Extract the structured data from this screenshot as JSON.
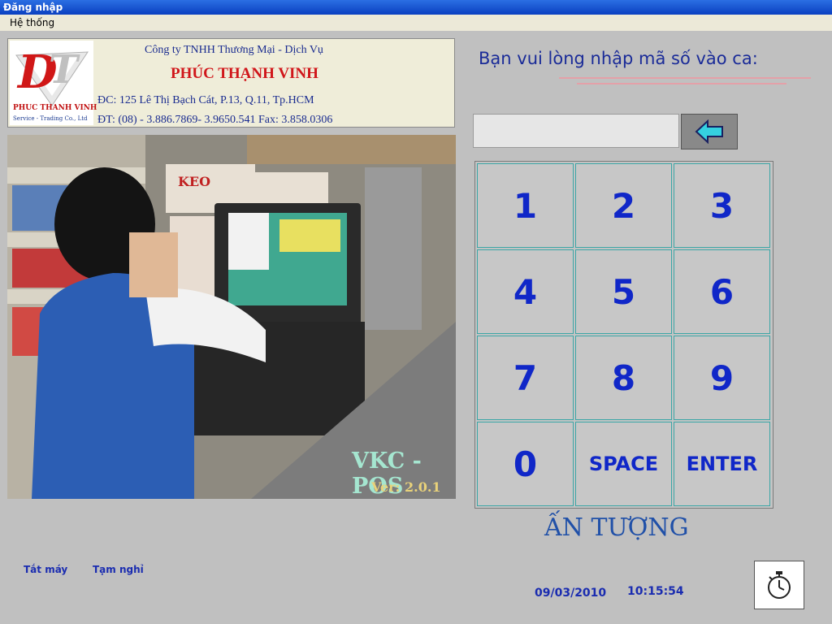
{
  "window": {
    "title": "Đăng nhập"
  },
  "menu": {
    "system": "Hệ thống"
  },
  "company": {
    "line1": "Công ty TNHH Thương Mại - Dịch Vụ",
    "name": "PHÚC THẠNH VINH",
    "address": "ĐC: 125 Lê Thị Bạch Cát, P.13, Q.11, Tp.HCM",
    "phone": "ĐT: (08) - 3.886.7869- 3.9650.541 Fax: 3.858.0306",
    "logo_text_1": "PHUC THANH VINH",
    "logo_text_2": "Service - Trading Co., Ltd"
  },
  "photo": {
    "brand": "VKC -POS",
    "version": "Ver: 2.0.1",
    "shelf_label": "KEO"
  },
  "login": {
    "prompt": "Bạn vui lòng nhập mã số vào ca:",
    "code_value": "",
    "back_icon": "backspace-arrow-icon"
  },
  "keypad": {
    "keys": [
      "1",
      "2",
      "3",
      "4",
      "5",
      "6",
      "7",
      "8",
      "9",
      "0",
      "SPACE",
      "ENTER"
    ]
  },
  "tagline": "ẤN TƯỢNG",
  "footer": {
    "shutdown": "Tắt máy",
    "pause": "Tạm nghỉ",
    "date": "09/03/2010",
    "time": "10:15:54",
    "timer_icon": "stopwatch-icon"
  },
  "colors": {
    "title_bar": "#0a3fc0",
    "key_text": "#1027c8",
    "company_name": "#d0161a",
    "accent_arrow": "#35d0e0"
  }
}
